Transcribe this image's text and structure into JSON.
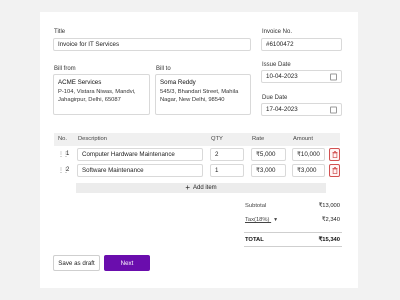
{
  "title": {
    "label": "Title",
    "value": "Invoice for IT Services"
  },
  "invoice_no": {
    "label": "Invoice No.",
    "value": "#6100472"
  },
  "bill_from": {
    "label": "Bill from",
    "name": "ACME Services",
    "address": "P-104, Vistara Niwas, Mandvi, Jahagirpur, Delhi, 65087"
  },
  "bill_to": {
    "label": "Bill to",
    "name": "Soma Reddy",
    "address": "545/3, Bhandari Street, Mahila Nagar, New Delhi, 98540"
  },
  "issue_date": {
    "label": "Issue Date",
    "value": "10-04-2023"
  },
  "due_date": {
    "label": "Due Date",
    "value": "17-04-2023"
  },
  "table": {
    "headers": {
      "no": "No.",
      "description": "Description",
      "qty": "QTY",
      "rate": "Rate",
      "amount": "Amount"
    },
    "rows": [
      {
        "no": "1",
        "description": "Computer Hardware Maintenance",
        "qty": "2",
        "rate": "₹5,000",
        "amount": "₹10,000"
      },
      {
        "no": "2",
        "description": "Software Maintenance",
        "qty": "1",
        "rate": "₹3,000",
        "amount": "₹3,000"
      }
    ],
    "add_item_label": "Add item"
  },
  "summary": {
    "subtotal_label": "Subtotal",
    "subtotal_value": "₹13,000",
    "tax_label": "Tax(18%)",
    "tax_value": "₹2,340",
    "total_label": "TOTAL",
    "total_value": "₹15,340"
  },
  "actions": {
    "draft_label": "Save as draft",
    "next_label": "Next"
  },
  "colors": {
    "primary": "#6a0dad",
    "danger": "#d25151"
  },
  "icons": {
    "drag": "drag-handle-icon",
    "delete": "trash-icon",
    "calendar": "calendar-icon",
    "add": "plus-icon",
    "tax_dropdown": "chevron-down-icon"
  }
}
